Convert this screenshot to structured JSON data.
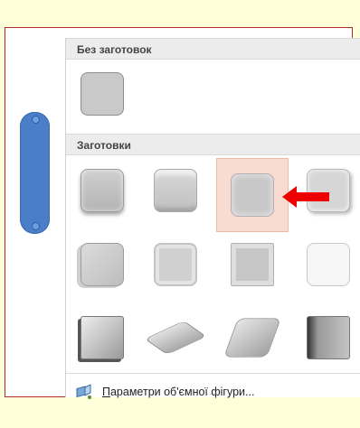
{
  "sections": {
    "no_presets": "Без заготовок",
    "presets": "Заготовки"
  },
  "footer": {
    "options_label": "Параметри об'ємної фігури...",
    "grip": "....."
  },
  "colors": {
    "background": "#ffffd9",
    "frame_border": "#b22a2a",
    "handle": "#4a7fc8",
    "selection": "#f8dcd2",
    "arrow": "#ee0000"
  },
  "selected_preset": 3,
  "preset_count": 12
}
